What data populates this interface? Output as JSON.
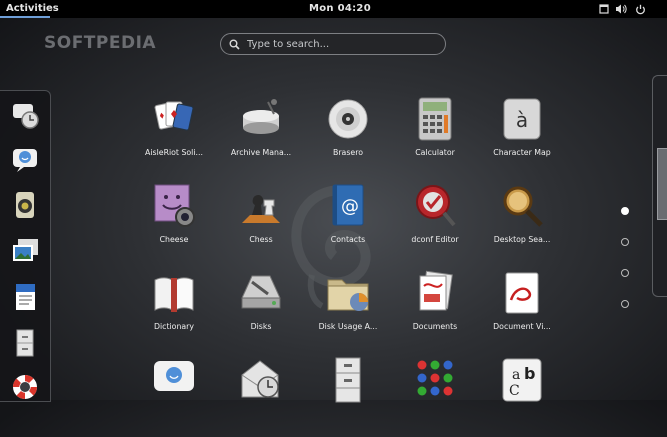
{
  "topbar": {
    "activities": "Activities",
    "clock": "Mon 04:20",
    "status_icons": [
      "window-icon",
      "volume-icon",
      "power-icon"
    ]
  },
  "watermark": "SOFTPEDIA",
  "search": {
    "placeholder": "Type to search..."
  },
  "dash": {
    "items": [
      "clock-notify-icon",
      "empathy-icon",
      "speaker-icon",
      "photos-icon",
      "writer-icon",
      "file-cabinet-icon",
      "help-lifebuoy-icon"
    ]
  },
  "apps": [
    {
      "label": "AisleRiot Soli...",
      "icon": "cards-icon"
    },
    {
      "label": "Archive Mana...",
      "icon": "archive-icon"
    },
    {
      "label": "Brasero",
      "icon": "disc-icon"
    },
    {
      "label": "Calculator",
      "icon": "calculator-icon"
    },
    {
      "label": "Character Map",
      "icon": "character-map-icon"
    },
    {
      "label": "Cheese",
      "icon": "cheese-icon"
    },
    {
      "label": "Chess",
      "icon": "chess-icon"
    },
    {
      "label": "Contacts",
      "icon": "contacts-icon"
    },
    {
      "label": "dconf Editor",
      "icon": "dconf-icon"
    },
    {
      "label": "Desktop Sea...",
      "icon": "magnifier-icon"
    },
    {
      "label": "Dictionary",
      "icon": "dictionary-icon"
    },
    {
      "label": "Disks",
      "icon": "disks-icon"
    },
    {
      "label": "Disk Usage A...",
      "icon": "disk-usage-icon"
    },
    {
      "label": "Documents",
      "icon": "documents-icon"
    },
    {
      "label": "Document Vi...",
      "icon": "document-viewer-icon"
    },
    {
      "label": "",
      "icon": "chat-icon"
    },
    {
      "label": "",
      "icon": "mail-clock-icon"
    },
    {
      "label": "",
      "icon": "drawer-icon"
    },
    {
      "label": "",
      "icon": "dots-game-icon"
    },
    {
      "label": "",
      "icon": "fonts-icon"
    }
  ],
  "pager": {
    "pages": 4,
    "active_page": 1
  },
  "colors": {
    "accent": "#6f9fd8",
    "topbar": "#000000"
  }
}
